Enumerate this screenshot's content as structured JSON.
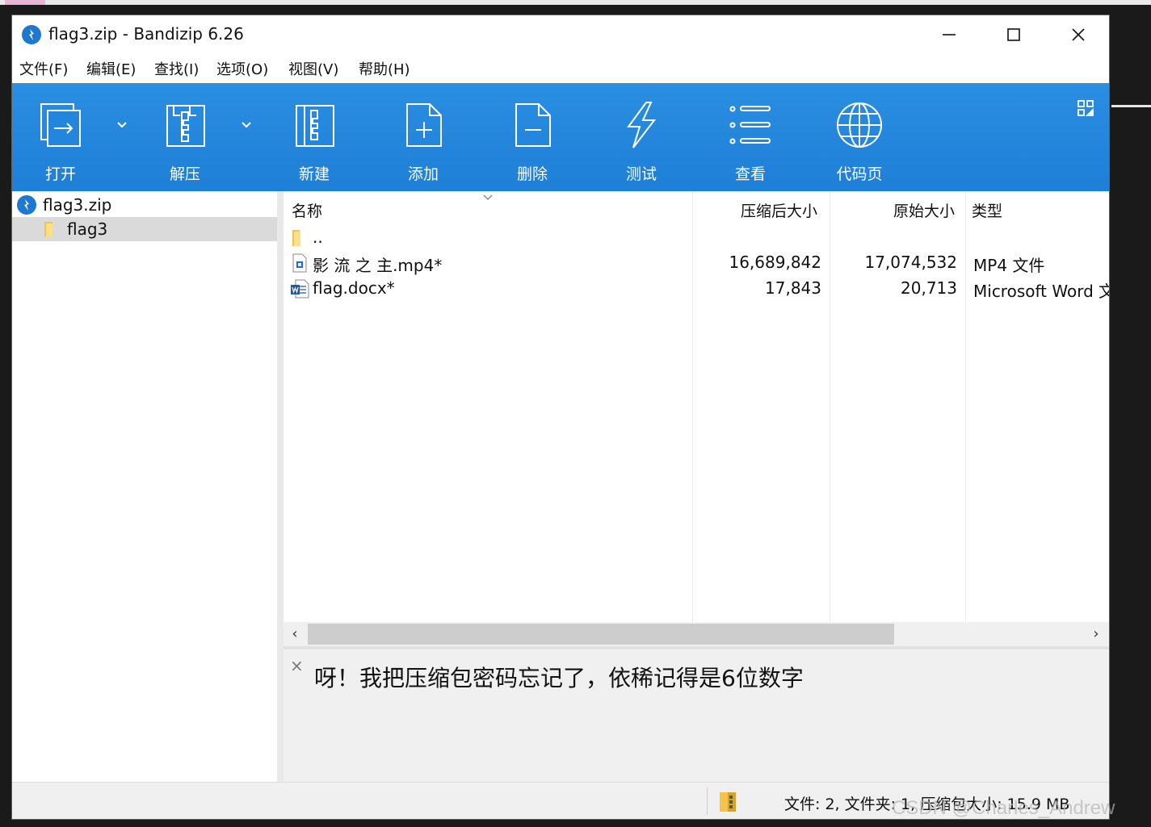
{
  "window": {
    "title": "flag3.zip - Bandizip 6.26"
  },
  "menu": [
    {
      "label": "文件(F)"
    },
    {
      "label": "编辑(E)"
    },
    {
      "label": "查找(I)"
    },
    {
      "label": "选项(O)"
    },
    {
      "label": "视图(V)"
    },
    {
      "label": "帮助(H)"
    }
  ],
  "toolbar": {
    "open": "打开",
    "extract": "解压",
    "new": "新建",
    "add": "添加",
    "delete": "删除",
    "test": "测试",
    "view": "查看",
    "codepage": "代码页",
    "accent": "#1e7fd6"
  },
  "tree": {
    "root": "flag3.zip",
    "child": "flag3"
  },
  "columns": {
    "name": "名称",
    "compressed": "压缩后大小",
    "original": "原始大小",
    "type": "类型"
  },
  "files": [
    {
      "name": "..",
      "compressed": "",
      "original": "",
      "type": "",
      "icon": "folder-icon"
    },
    {
      "name": "影 流 之 主.mp4*",
      "compressed": "16,689,842",
      "original": "17,074,532",
      "type": "MP4 文件",
      "icon": "video-file-icon"
    },
    {
      "name": "flag.docx*",
      "compressed": "17,843",
      "original": "20,713",
      "type": "Microsoft Word 文",
      "icon": "word-file-icon"
    }
  ],
  "comment": {
    "close": "×",
    "text": "呀！我把压缩包密码忘记了，依稀记得是6位数字"
  },
  "status": {
    "text": "文件: 2, 文件夹: 1, 压缩包大小: 15.9 MB"
  },
  "watermark": "CSDN @Charles_Andrew"
}
